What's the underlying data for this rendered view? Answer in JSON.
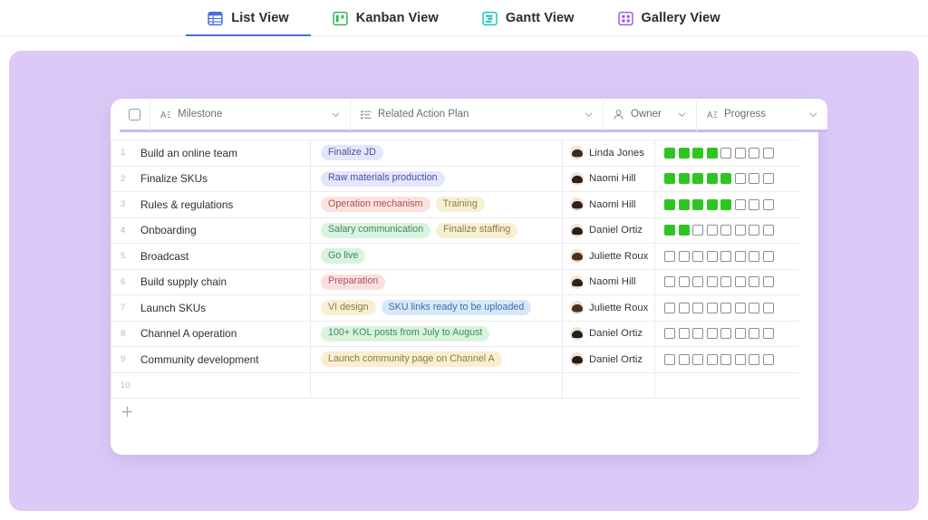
{
  "tabs": [
    {
      "label": "List View",
      "icon": "list-view-icon",
      "color": "#4a6ee0",
      "active": true
    },
    {
      "label": "Kanban View",
      "icon": "kanban-view-icon",
      "color": "#32b84f",
      "active": false
    },
    {
      "label": "Gantt View",
      "icon": "gantt-view-icon",
      "color": "#19c5c0",
      "active": false
    },
    {
      "label": "Gallery View",
      "icon": "gallery-view-icon",
      "color": "#9b5de5",
      "active": false
    }
  ],
  "table": {
    "header": {
      "select_all": "",
      "columns": [
        {
          "label": "Milestone",
          "icon": "text-field-icon",
          "chevron": true
        },
        {
          "label": "Related Action Plan",
          "icon": "multi-select-icon",
          "chevron": true
        },
        {
          "label": "Owner",
          "icon": "person-icon",
          "chevron": true
        },
        {
          "label": "Progress",
          "icon": "text-field-icon",
          "chevron": true
        }
      ]
    },
    "rows": [
      {
        "index": "1",
        "milestone": "Build an online team",
        "tags": [
          {
            "text": "Finalize JD",
            "bg": "#e4e6fb",
            "fg": "#4a4f9e"
          }
        ],
        "owner": {
          "name": "Linda Jones",
          "skin": "#d8a882",
          "hair": "#3b2a22"
        },
        "progress_filled": 4,
        "progress_total": 8
      },
      {
        "index": "2",
        "milestone": "Finalize SKUs",
        "tags": [
          {
            "text": "Raw materials production",
            "bg": "#e4e6fb",
            "fg": "#4a4f9e"
          }
        ],
        "owner": {
          "name": "Naomi Hill",
          "skin": "#caa07e",
          "hair": "#2f2119"
        },
        "progress_filled": 5,
        "progress_total": 8
      },
      {
        "index": "3",
        "milestone": "Rules & regulations",
        "tags": [
          {
            "text": "Operation mechanism",
            "bg": "#fbe2de",
            "fg": "#a8564a"
          },
          {
            "text": "Training",
            "bg": "#f8f0d5",
            "fg": "#8d7b41"
          }
        ],
        "owner": {
          "name": "Naomi Hill",
          "skin": "#caa07e",
          "hair": "#2f2119"
        },
        "progress_filled": 5,
        "progress_total": 8
      },
      {
        "index": "4",
        "milestone": "Onboarding",
        "tags": [
          {
            "text": "Salary communication",
            "bg": "#d9f3df",
            "fg": "#3f8a56"
          },
          {
            "text": "Finalize staffing",
            "bg": "#f8f0d5",
            "fg": "#8d7b41"
          }
        ],
        "owner": {
          "name": "Daniel Ortiz",
          "skin": "#b7865f",
          "hair": "#23201c"
        },
        "progress_filled": 2,
        "progress_total": 8
      },
      {
        "index": "5",
        "milestone": "Broadcast",
        "tags": [
          {
            "text": "Go live",
            "bg": "#d9f3df",
            "fg": "#3f8a56"
          }
        ],
        "owner": {
          "name": "Juliette Roux",
          "skin": "#c08f6b",
          "hair": "#4a2f22"
        },
        "progress_filled": 0,
        "progress_total": 8
      },
      {
        "index": "6",
        "milestone": "Build supply chain",
        "tags": [
          {
            "text": "Preparation",
            "bg": "#fbdfe0",
            "fg": "#a8545b"
          }
        ],
        "owner": {
          "name": "Naomi Hill",
          "skin": "#caa07e",
          "hair": "#2f2119"
        },
        "progress_filled": 0,
        "progress_total": 8
      },
      {
        "index": "7",
        "milestone": "Launch SKUs",
        "tags": [
          {
            "text": "VI design",
            "bg": "#f8f0d5",
            "fg": "#8d7b41"
          },
          {
            "text": "SKU links ready to be uploaded",
            "bg": "#d7e8fb",
            "fg": "#3d6da3"
          }
        ],
        "owner": {
          "name": "Juliette Roux",
          "skin": "#c08f6b",
          "hair": "#4a2f22"
        },
        "progress_filled": 0,
        "progress_total": 8
      },
      {
        "index": "8",
        "milestone": "Channel A operation",
        "tags": [
          {
            "text": "100+ KOL posts from July to August",
            "bg": "#d9f3df",
            "fg": "#3f8a56"
          }
        ],
        "owner": {
          "name": "Daniel Ortiz",
          "skin": "#b7865f",
          "hair": "#23201c"
        },
        "progress_filled": 0,
        "progress_total": 8
      },
      {
        "index": "9",
        "milestone": "Community development",
        "tags": [
          {
            "text": "Launch community page on Channel A",
            "bg": "#f9eed0",
            "fg": "#8d7b41"
          }
        ],
        "owner": {
          "name": "Daniel Ortiz",
          "skin": "#b7865f",
          "hair": "#23201c"
        },
        "progress_filled": 0,
        "progress_total": 8
      },
      {
        "index": "10",
        "milestone": "",
        "tags": [],
        "owner": null,
        "progress_filled": 0,
        "progress_total": 0
      }
    ],
    "add_row_label": "+"
  },
  "colors": {
    "stage_background": "#dcc9f7",
    "header_underline": "#cdb6f0",
    "progress_filled": "#2fc520",
    "active_tab_underline": "#4a6ee0"
  }
}
